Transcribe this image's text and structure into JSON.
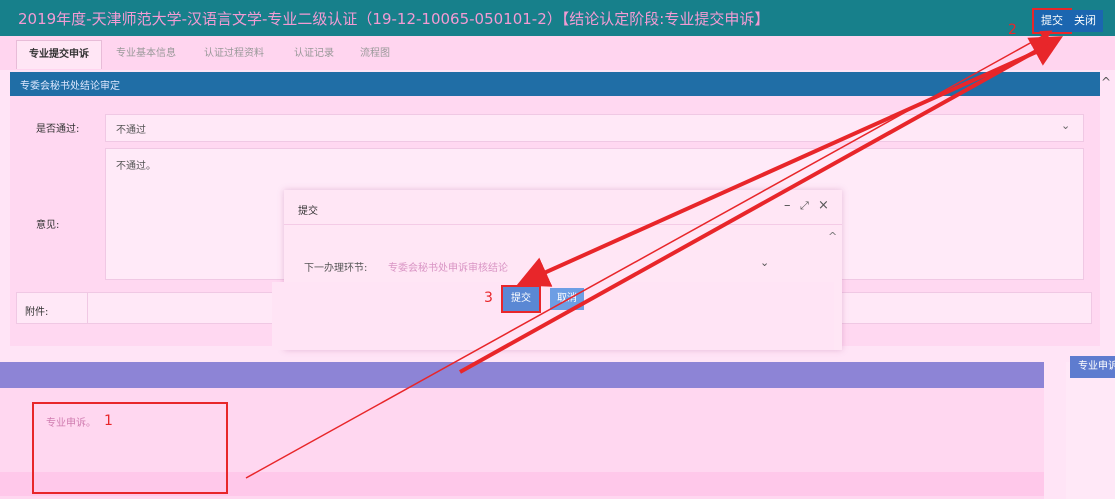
{
  "header": {
    "title": "2019年度-天津师范大学-汉语言文学-专业二级认证（19-12-10065-050101-2）【结论认定阶段:专业提交申诉】",
    "submit_label": "提交",
    "close_label": "关闭"
  },
  "tabs": [
    {
      "label": "专业提交申诉",
      "active": true
    },
    {
      "label": "专业基本信息",
      "active": false
    },
    {
      "label": "认证过程资料",
      "active": false
    },
    {
      "label": "认证记录",
      "active": false
    },
    {
      "label": "流程图",
      "active": false
    }
  ],
  "panel": {
    "title": "专委会秘书处结论审定",
    "pass_label": "是否通过:",
    "pass_value": "不通过",
    "opinion_label": "意见:",
    "opinion_value": "不通过。",
    "attachment_label": "附件:"
  },
  "dialog": {
    "title": "提交",
    "next_step_label": "下一办理环节:",
    "next_step_value": "专委会秘书处申诉审核结论",
    "submit_label": "提交",
    "cancel_label": "取消"
  },
  "lower": {
    "appeal_text": "专业申诉。",
    "right_header": "专业申诉"
  },
  "annotations": {
    "step1": "1",
    "step2": "2",
    "step3": "3"
  },
  "colors": {
    "topbar": "#17808b",
    "accent_blue": "#1b66b0",
    "highlight_red": "#e8262a"
  },
  "icons": [
    "chevron-down-icon",
    "minimize-icon",
    "maximize-icon",
    "close-icon",
    "chevron-up-icon"
  ]
}
